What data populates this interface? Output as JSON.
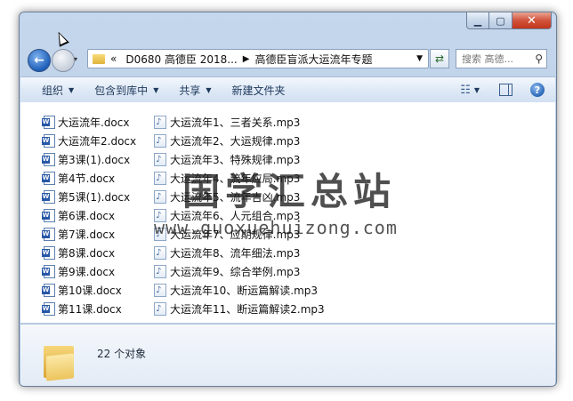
{
  "address": {
    "overflow": "«",
    "crumbs": [
      "D0680 高德臣 2018...",
      "高德臣盲派大运流年专题"
    ]
  },
  "search": {
    "placeholder": "搜索 高德..."
  },
  "toolbar": {
    "organize": "组织",
    "include_in_library": "包含到库中",
    "share": "共享",
    "new_folder": "新建文件夹"
  },
  "files": {
    "column1": [
      "大运流年.docx",
      "大运流年2.docx",
      "第3课(1).docx",
      "第4节.docx",
      "第5课(1).docx",
      "第6课.docx",
      "第7课.docx",
      "第8课.docx",
      "第9课.docx",
      "第10课.docx",
      "第11课.docx"
    ],
    "column2": [
      "大运流年1、三者关系.mp3",
      "大运流年2、大运规律.mp3",
      "大运流年3、特殊规律.mp3",
      "大运流年4、流年应局.mp3",
      "大运流年5、流年吉凶.mp3",
      "大运流年6、人元组合.mp3",
      "大运流年7、应期规律.mp3",
      "大运流年8、流年细法.mp3",
      "大运流年9、综合举例.mp3",
      "大运流年10、断运篇解读.mp3",
      "大运流年11、断运篇解读2.mp3"
    ]
  },
  "watermark": {
    "text": "国学汇总站",
    "url": "www.guoxuehuizong.com"
  },
  "status": {
    "count": "22 个对象"
  },
  "icons": {
    "doc": "word-document-icon",
    "audio": "audio-file-icon",
    "folder": "folder-icon"
  }
}
